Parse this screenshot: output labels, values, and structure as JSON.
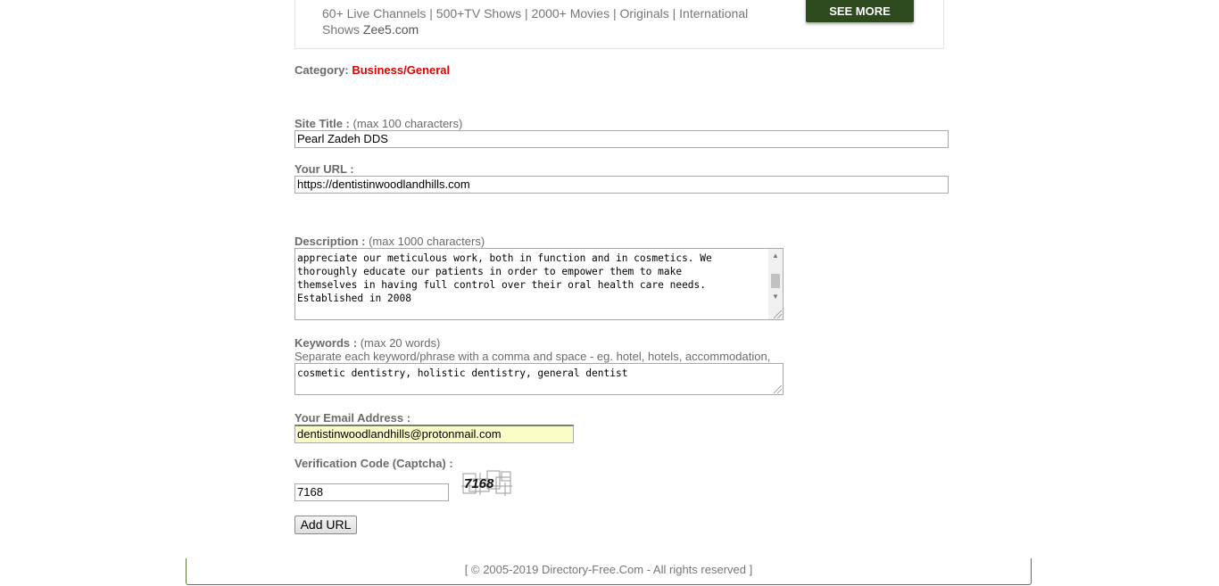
{
  "ad": {
    "description": "60+ Live Channels | 500+TV Shows | 2000+ Movies | Originals | International Shows",
    "domain": "Zee5.com",
    "cta_label": "SEE MORE"
  },
  "category": {
    "label": "Category:",
    "value": "Business/General"
  },
  "site_title": {
    "label": "Site Title :",
    "hint": "(max 100 characters)",
    "value": "Pearl Zadeh DDS"
  },
  "url": {
    "label": "Your URL :",
    "value": "https://dentistinwoodlandhills.com"
  },
  "description": {
    "label": "Description :",
    "hint": "(max 1000 characters)",
    "lines": [
      "appreciate our meticulous work, both in function and in cosmetics. We",
      "thoroughly educate our patients in order to empower them to make",
      "themselves in having full control over their oral health care needs.",
      "Established in 2008"
    ]
  },
  "keywords": {
    "label": "Keywords :",
    "hint": "(max 20 words)",
    "note": "Separate each keyword/phrase with a comma and space - eg. hotel, hotels, accommodation,",
    "value": "cosmetic dentistry, holistic dentistry, general dentist"
  },
  "email": {
    "label": "Your Email Address :",
    "value": "dentistinwoodlandhills@protonmail.com"
  },
  "captcha": {
    "label": "Verification Code (Captcha) :",
    "value": "7168",
    "image_code": "7168"
  },
  "submit": {
    "label": "Add URL"
  },
  "footer": {
    "text": "[ © 2005-2019 Directory-Free.Com - All rights reserved ]"
  },
  "colors": {
    "accent_red": "#e00000",
    "button_green": "#2c4a1c",
    "email_bg": "#fafdc6"
  }
}
